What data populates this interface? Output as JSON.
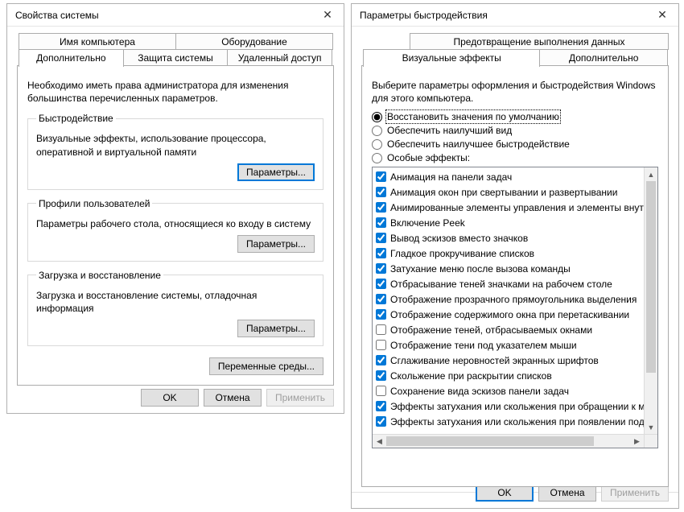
{
  "left": {
    "title": "Свойства системы",
    "tabs_row1": [
      "Имя компьютера",
      "Оборудование"
    ],
    "tabs_row2": [
      "Дополнительно",
      "Защита системы",
      "Удаленный доступ"
    ],
    "active_tab": "Дополнительно",
    "intro": "Необходимо иметь права администратора для изменения большинства перечисленных параметров.",
    "groups": {
      "perf": {
        "legend": "Быстродействие",
        "desc": "Визуальные эффекты, использование процессора, оперативной и виртуальной памяти",
        "button": "Параметры..."
      },
      "profiles": {
        "legend": "Профили пользователей",
        "desc": "Параметры рабочего стола, относящиеся ко входу в систему",
        "button": "Параметры..."
      },
      "startup": {
        "legend": "Загрузка и восстановление",
        "desc": "Загрузка и восстановление системы, отладочная информация",
        "button": "Параметры..."
      }
    },
    "env_button": "Переменные среды...",
    "footer": {
      "ok": "OK",
      "cancel": "Отмена",
      "apply": "Применить"
    }
  },
  "right": {
    "title": "Параметры быстродействия",
    "tabs_row1": [
      "Предотвращение выполнения данных"
    ],
    "tabs_row2": [
      "Визуальные эффекты",
      "Дополнительно"
    ],
    "active_tab": "Визуальные эффекты",
    "intro": "Выберите параметры оформления и быстродействия Windows для этого компьютера.",
    "radios": [
      {
        "label": "Восстановить значения по умолчанию",
        "selected": true
      },
      {
        "label": "Обеспечить наилучший вид",
        "selected": false
      },
      {
        "label": "Обеспечить наилучшее быстродействие",
        "selected": false
      },
      {
        "label": "Особые эффекты:",
        "selected": false
      }
    ],
    "effects": [
      {
        "label": "Анимация на панели задач",
        "checked": true
      },
      {
        "label": "Анимация окон при свертывании и развертывании",
        "checked": true
      },
      {
        "label": "Анимированные элементы управления и элементы внутри окна",
        "checked": true
      },
      {
        "label": "Включение Peek",
        "checked": true
      },
      {
        "label": "Вывод эскизов вместо значков",
        "checked": true
      },
      {
        "label": "Гладкое прокручивание списков",
        "checked": true
      },
      {
        "label": "Затухание меню после вызова команды",
        "checked": true
      },
      {
        "label": "Отбрасывание теней значками на рабочем столе",
        "checked": true
      },
      {
        "label": "Отображение прозрачного прямоугольника выделения",
        "checked": true
      },
      {
        "label": "Отображение содержимого окна при перетаскивании",
        "checked": true
      },
      {
        "label": "Отображение теней, отбрасываемых окнами",
        "checked": false
      },
      {
        "label": "Отображение тени под указателем мыши",
        "checked": false
      },
      {
        "label": "Сглаживание неровностей экранных шрифтов",
        "checked": true
      },
      {
        "label": "Скольжение при раскрытии списков",
        "checked": true
      },
      {
        "label": "Сохранение вида эскизов панели задач",
        "checked": false
      },
      {
        "label": "Эффекты затухания или скольжения при обращении к меню",
        "checked": true
      },
      {
        "label": "Эффекты затухания или скольжения при появлении подсказок",
        "checked": true
      }
    ],
    "footer": {
      "ok": "OK",
      "cancel": "Отмена",
      "apply": "Применить"
    }
  }
}
